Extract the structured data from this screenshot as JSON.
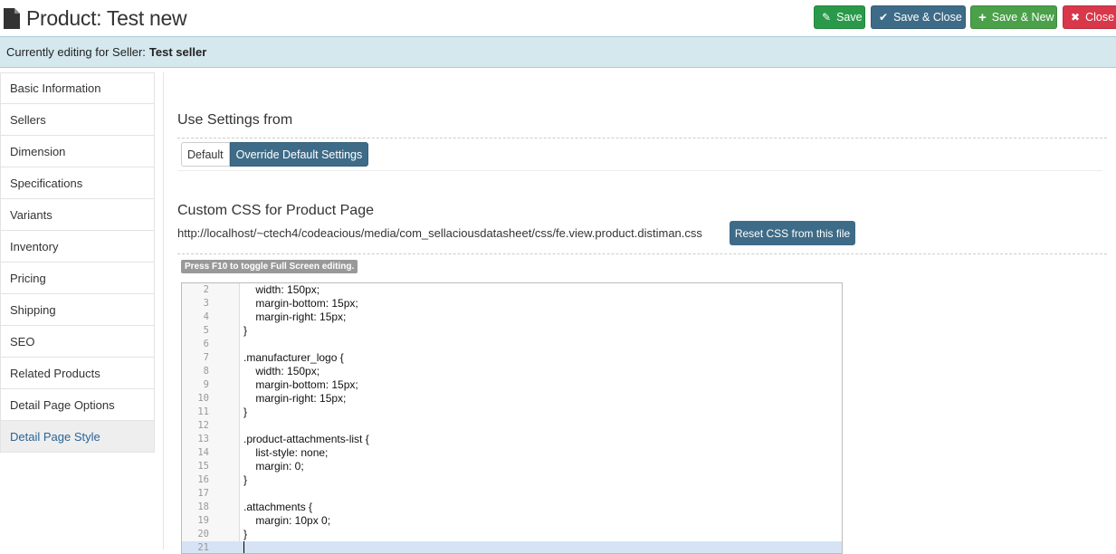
{
  "header": {
    "title": "Product: Test new",
    "buttons": {
      "save": "Save",
      "save_close": "Save & Close",
      "save_new": "Save & New",
      "close": "Close"
    }
  },
  "seller_bar": {
    "prefix": "Currently editing for Seller:",
    "seller": "Test seller"
  },
  "sidebar": {
    "items": [
      "Basic Information",
      "Sellers",
      "Dimension",
      "Specifications",
      "Variants",
      "Inventory",
      "Pricing",
      "Shipping",
      "SEO",
      "Related Products",
      "Detail Page Options",
      "Detail Page Style"
    ],
    "active": "Detail Page Style"
  },
  "settings": {
    "title": "Use Settings from",
    "options": [
      "Default",
      "Override Default Settings"
    ],
    "selected": "Override Default Settings"
  },
  "custom_css": {
    "title": "Custom CSS for Product Page",
    "path": "http://localhost/~ctech4/codeacious/media/com_sellaciousdatasheet/css/fe.view.product.distiman.css",
    "reset_label": "Reset CSS from this file",
    "hint": "Press F10 to toggle Full Screen editing."
  },
  "editor": {
    "lines": [
      {
        "n": "2",
        "t": "    width: 150px;"
      },
      {
        "n": "3",
        "t": "    margin-bottom: 15px;"
      },
      {
        "n": "4",
        "t": "    margin-right: 15px;"
      },
      {
        "n": "5",
        "t": "}"
      },
      {
        "n": "6",
        "t": ""
      },
      {
        "n": "7",
        "t": ".manufacturer_logo {"
      },
      {
        "n": "8",
        "t": "    width: 150px;"
      },
      {
        "n": "9",
        "t": "    margin-bottom: 15px;"
      },
      {
        "n": "10",
        "t": "    margin-right: 15px;"
      },
      {
        "n": "11",
        "t": "}"
      },
      {
        "n": "12",
        "t": ""
      },
      {
        "n": "13",
        "t": ".product-attachments-list {"
      },
      {
        "n": "14",
        "t": "    list-style: none;"
      },
      {
        "n": "15",
        "t": "    margin: 0;"
      },
      {
        "n": "16",
        "t": "}"
      },
      {
        "n": "17",
        "t": ""
      },
      {
        "n": "18",
        "t": ".attachments {"
      },
      {
        "n": "19",
        "t": "    margin: 10px 0;"
      },
      {
        "n": "20",
        "t": "}"
      },
      {
        "n": "21",
        "t": ""
      }
    ],
    "current_line": "21"
  },
  "colors": {
    "save": "#2a9a4a",
    "save_close": "#3e6b87",
    "save_new": "#4ba04a",
    "close": "#d9384a",
    "seller_bar": "#d5e8ee",
    "accent": "#3e6b87"
  }
}
